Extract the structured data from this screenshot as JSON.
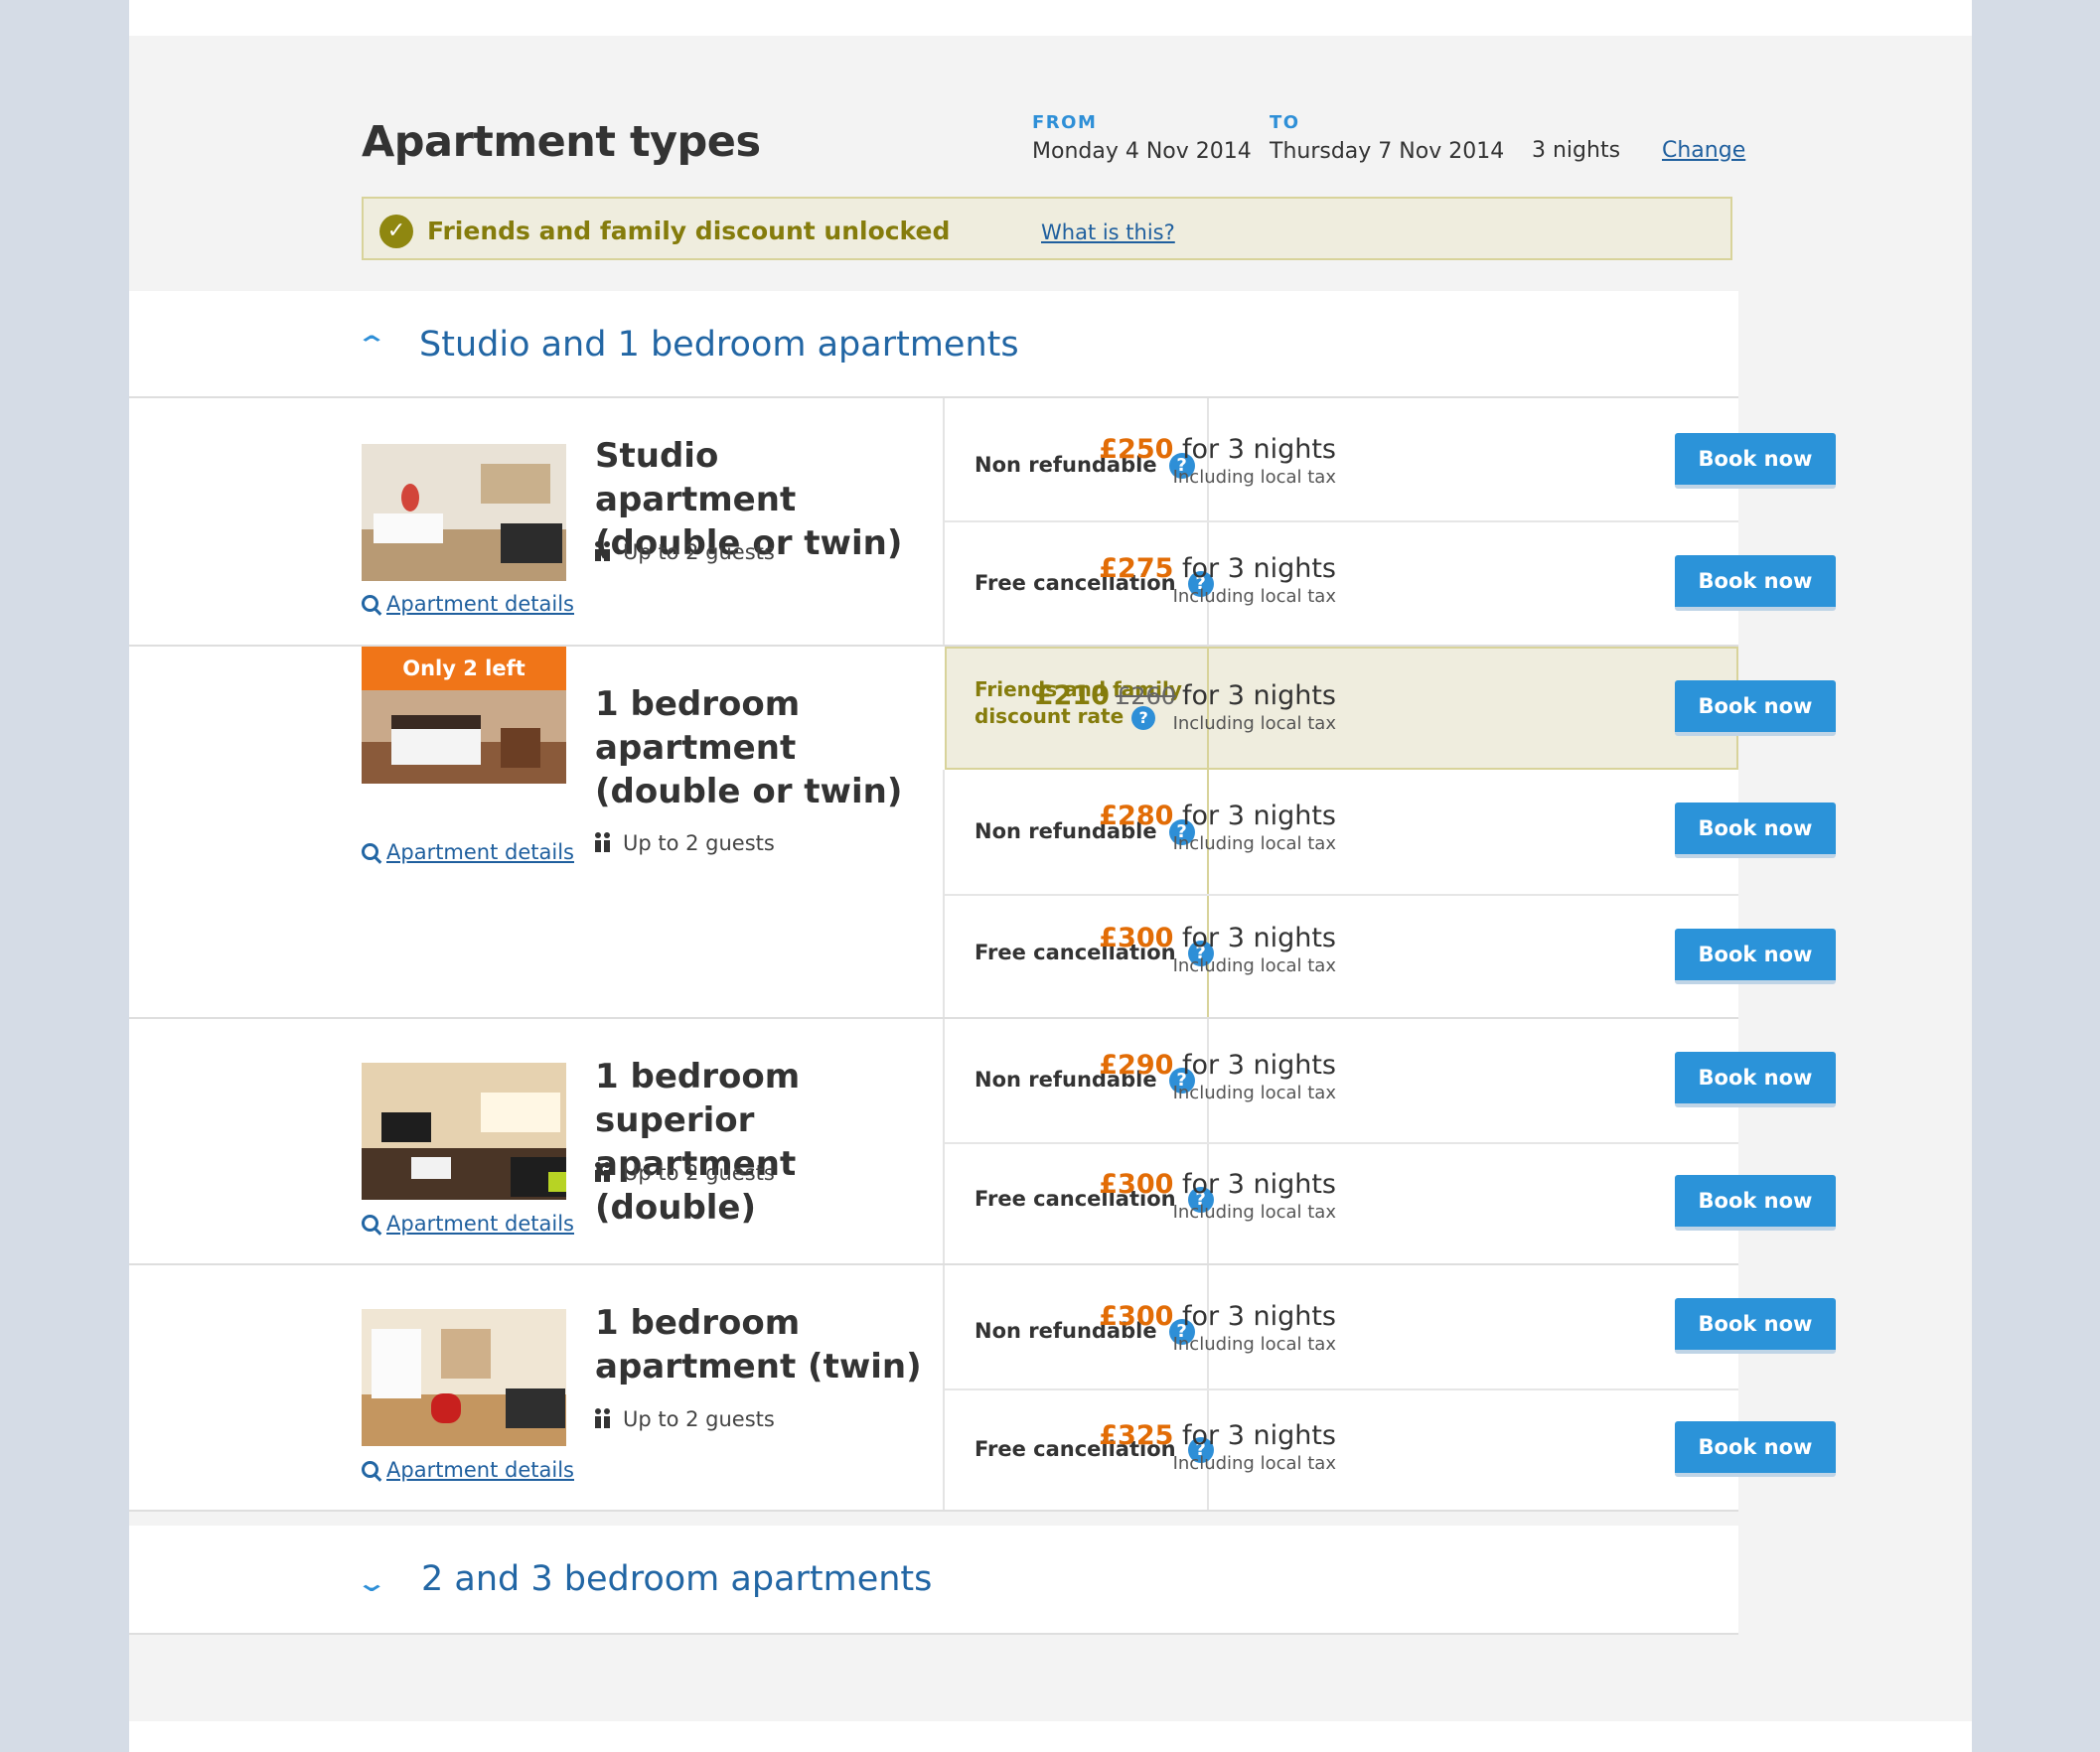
{
  "header": {
    "title": "Apartment types",
    "from_label": "FROM",
    "from_date": "Monday 4 Nov 2014",
    "to_label": "TO",
    "to_date": "Thursday 7 Nov 2014",
    "nights": "3 nights",
    "change": "Change"
  },
  "banner": {
    "check": "✓",
    "text": "Friends and family discount unlocked",
    "link": "What is this?"
  },
  "sections": [
    {
      "chevron": "⌃",
      "title": "Studio and 1 bedroom apartments",
      "expanded": true
    },
    {
      "chevron": "⌄",
      "title": "2 and 3 bedroom apartments",
      "expanded": false
    }
  ],
  "common": {
    "details_link": "Apartment details",
    "help": "?",
    "book": "Book now",
    "for_nights": "for 3 nights",
    "tax": "Including local tax"
  },
  "rooms": [
    {
      "name": "Studio apartment (double or twin)",
      "guests": "Up to 2 guests",
      "badge": "",
      "rates": [
        {
          "name": "Non refundable",
          "price": "£250"
        },
        {
          "name": "Free cancellation",
          "price": "£275"
        }
      ]
    },
    {
      "name": "1 bedroom apartment (double or twin)",
      "guests": "Up to 2 guests",
      "badge": "Only 2 left",
      "rates": [
        {
          "name": "Friends and family discount rate",
          "price": "£210",
          "old_price": "£260",
          "highlight": true
        },
        {
          "name": "Non refundable",
          "price": "£280"
        },
        {
          "name": "Free cancellation",
          "price": "£300"
        }
      ]
    },
    {
      "name": "1 bedroom superior apartment (double)",
      "guests": "Up to 2 guests",
      "badge": "",
      "rates": [
        {
          "name": "Non refundable",
          "price": "£290"
        },
        {
          "name": "Free cancellation",
          "price": "£300"
        }
      ]
    },
    {
      "name": "1 bedroom apartment (twin)",
      "guests": "Up to 2 guests",
      "badge": "",
      "rates": [
        {
          "name": "Non refundable",
          "price": "£300"
        },
        {
          "name": "Free cancellation",
          "price": "£325"
        }
      ]
    }
  ],
  "colors": {
    "accent": "#2e8fd7",
    "price": "#e26c06",
    "discount": "#857c0c",
    "badge": "#f07518"
  }
}
